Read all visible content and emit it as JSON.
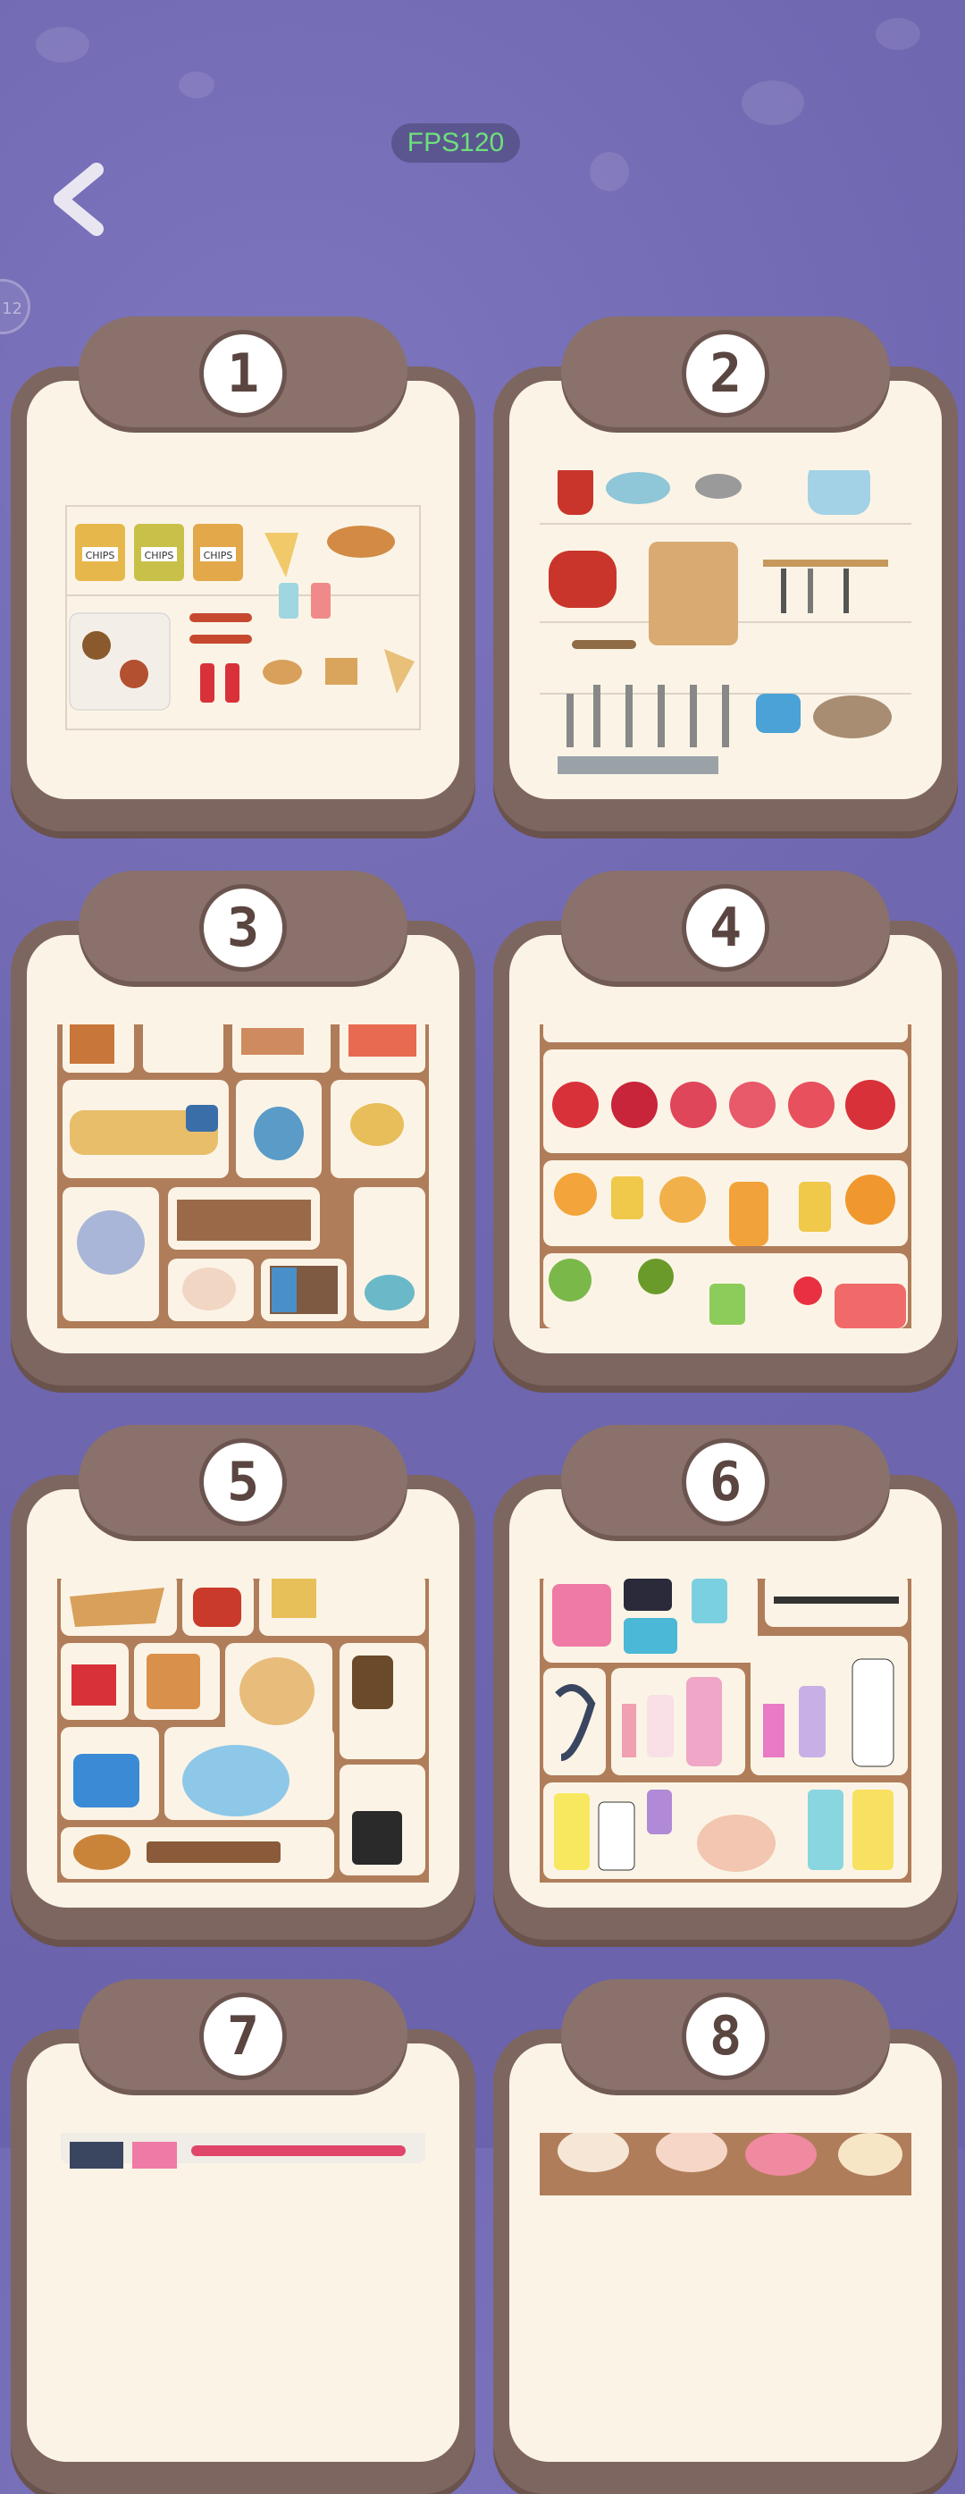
{
  "hud": {
    "fps": "FPS120",
    "side_badge": "12"
  },
  "levels": [
    {
      "number": "1",
      "label": "CHIPS"
    },
    {
      "number": "2"
    },
    {
      "number": "3"
    },
    {
      "number": "4"
    },
    {
      "number": "5"
    },
    {
      "number": "6"
    },
    {
      "number": "7"
    },
    {
      "number": "8"
    }
  ],
  "colors": {
    "background": "#6f67b0",
    "card_frame": "#7e6660",
    "card_panel": "#fbf4e6",
    "fps_text": "#6ee07a"
  },
  "icons": [
    "back-arrow-icon"
  ]
}
